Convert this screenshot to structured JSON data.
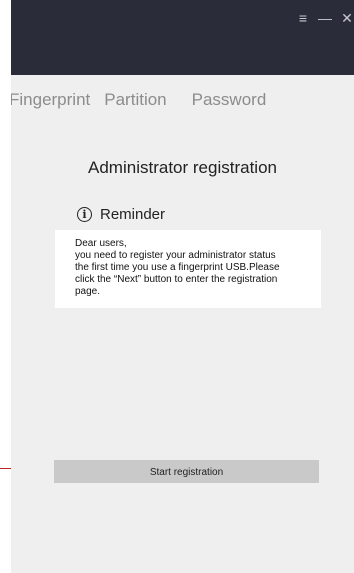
{
  "window": {
    "controls": {
      "menu_icon": "≡",
      "minimize_icon": "—",
      "close_icon": "✕"
    }
  },
  "tabs": [
    {
      "label": "Fingerprint"
    },
    {
      "label": "Partition"
    },
    {
      "label": "Password"
    }
  ],
  "main": {
    "title": "Administrator registration",
    "reminder": {
      "icon": "info-circle-icon",
      "label": "Reminder"
    },
    "message": {
      "line1": "Dear users,",
      "line2": "you need to register your administrator status",
      "line3": "the first time you use a fingerprint USB.Please",
      "line4": "click the “Next” button to enter the registration",
      "line5": "page."
    },
    "start_button_label": "Start registration"
  },
  "colors": {
    "titlebar": "#2b2c3a",
    "background": "#efefef",
    "button": "#c9c9c9",
    "pointer_line": "#b3262b"
  }
}
